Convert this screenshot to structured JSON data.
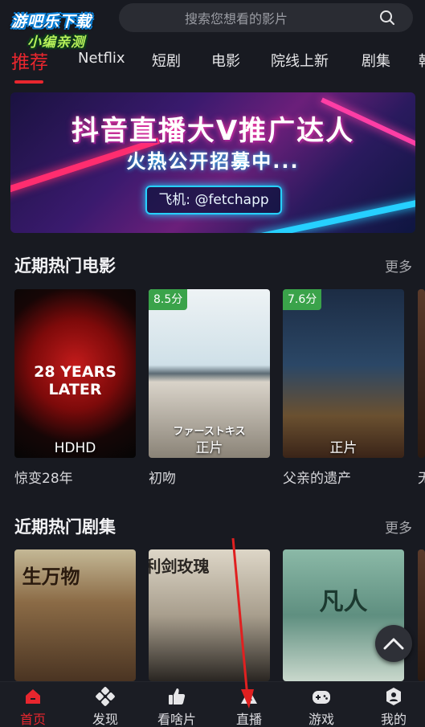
{
  "watermark": {
    "line1": "游吧乐下载",
    "line2": "小编亲测"
  },
  "search": {
    "placeholder": "搜索您想看的影片"
  },
  "tabs": [
    {
      "label": "推荐",
      "active": true
    },
    {
      "label": "Netflix"
    },
    {
      "label": "短剧"
    },
    {
      "label": "电影"
    },
    {
      "label": "院线上新"
    },
    {
      "label": "剧集"
    },
    {
      "label": "韩"
    }
  ],
  "banner": {
    "line1": "抖音直播大V推广达人",
    "line2": "火热公开招募中...",
    "contact": "飞机: @fetchapp"
  },
  "movies_section": {
    "title": "近期热门电影",
    "more": "更多",
    "items": [
      {
        "title": "惊变28年",
        "badge": "HDHD",
        "score": "",
        "poster_text": "28 YEARS LATER"
      },
      {
        "title": "初吻",
        "badge": "正片",
        "score": "8.5分",
        "poster_text": "ファーストキス"
      },
      {
        "title": "父亲的遗产",
        "badge": "正片",
        "score": "7.6分",
        "poster_text": ""
      },
      {
        "title": "无",
        "badge": "",
        "score": "",
        "poster_text": ""
      }
    ]
  },
  "series_section": {
    "title": "近期热门剧集",
    "more": "更多",
    "items": [
      {
        "title": "",
        "poster_text": "生万物"
      },
      {
        "title": "",
        "poster_text": "利剑玫瑰"
      },
      {
        "title": "",
        "poster_text": "凡人"
      },
      {
        "title": "",
        "poster_text": ""
      }
    ]
  },
  "bottom_nav": [
    {
      "label": "首页",
      "icon": "home-icon",
      "active": true
    },
    {
      "label": "发现",
      "icon": "discover-icon"
    },
    {
      "label": "看啥片",
      "icon": "thumbs-up-icon"
    },
    {
      "label": "直播",
      "icon": "live-icon"
    },
    {
      "label": "游戏",
      "icon": "gamepad-icon"
    },
    {
      "label": "我的",
      "icon": "profile-icon"
    }
  ],
  "colors": {
    "accent": "#e8262e",
    "background": "#181a21",
    "score_badge": "#3aa34a"
  }
}
